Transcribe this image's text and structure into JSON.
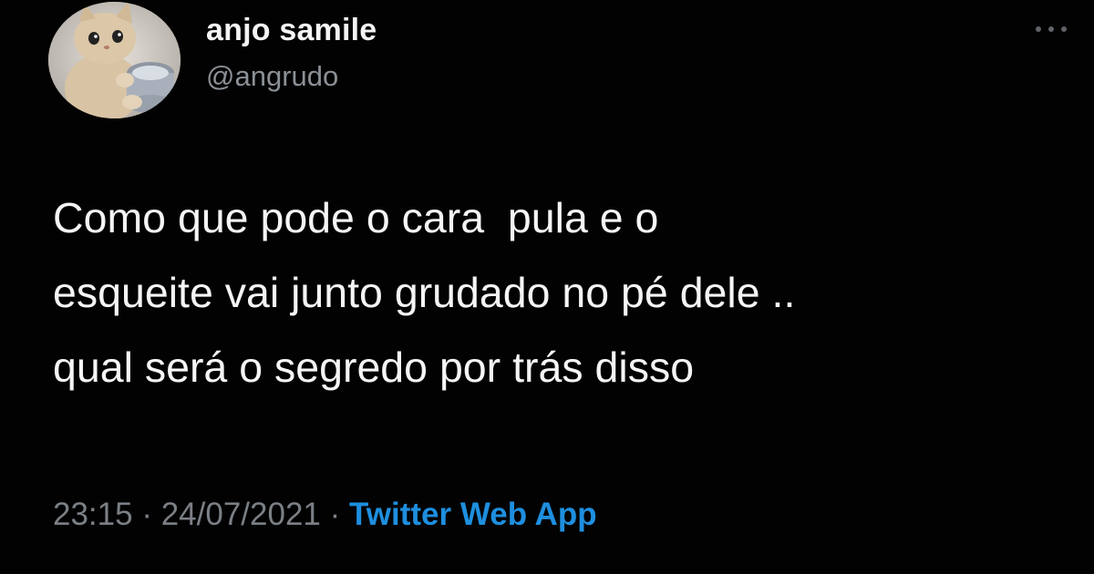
{
  "user": {
    "name": "anjo samile",
    "handle": "@angrudo"
  },
  "tweet": {
    "lines": [
      "Como que pode o cara  pula e o",
      "esqueite vai junto grudado no pé dele ..",
      "qual será o segredo por trás disso"
    ],
    "time": "23:15",
    "date": "24/07/2021",
    "separator": "·",
    "source": "Twitter Web App"
  },
  "icons": {
    "more": "more-options-icon",
    "avatar": "kitten-avatar"
  },
  "colors": {
    "background": "#020202",
    "name": "#f4f4f4",
    "handle": "#8b9096",
    "text": "#f5f5f5",
    "meta": "#7b8086",
    "source": "#1e8fdf"
  }
}
